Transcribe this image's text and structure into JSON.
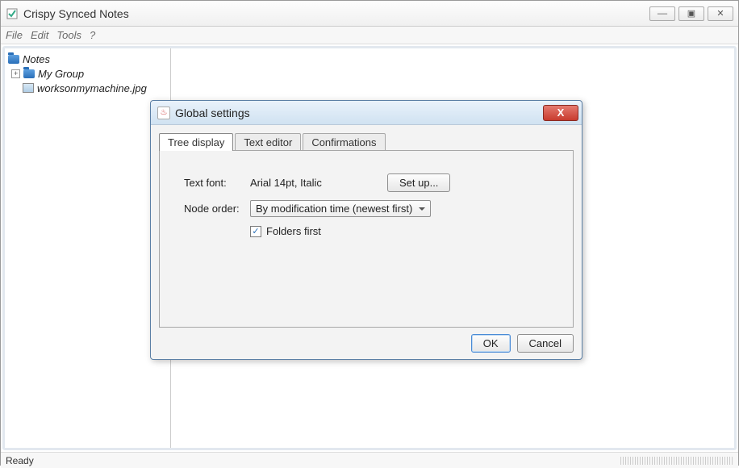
{
  "window": {
    "title": "Crispy Synced Notes"
  },
  "menubar": {
    "file": "File",
    "edit": "Edit",
    "tools": "Tools",
    "help": "?"
  },
  "tree": {
    "root": "Notes",
    "group": "My Group",
    "file": "worksonmymachine.jpg"
  },
  "status": {
    "text": "Ready"
  },
  "dialog": {
    "title": "Global settings",
    "tabs": {
      "tree_display": "Tree display",
      "text_editor": "Text editor",
      "confirmations": "Confirmations"
    },
    "form": {
      "text_font_label": "Text font:",
      "text_font_value": "Arial 14pt, Italic",
      "setup_button": "Set up...",
      "node_order_label": "Node order:",
      "node_order_value": "By modification time (newest first)",
      "folders_first_label": "Folders first",
      "folders_first_checked": true
    },
    "buttons": {
      "ok": "OK",
      "cancel": "Cancel"
    }
  }
}
